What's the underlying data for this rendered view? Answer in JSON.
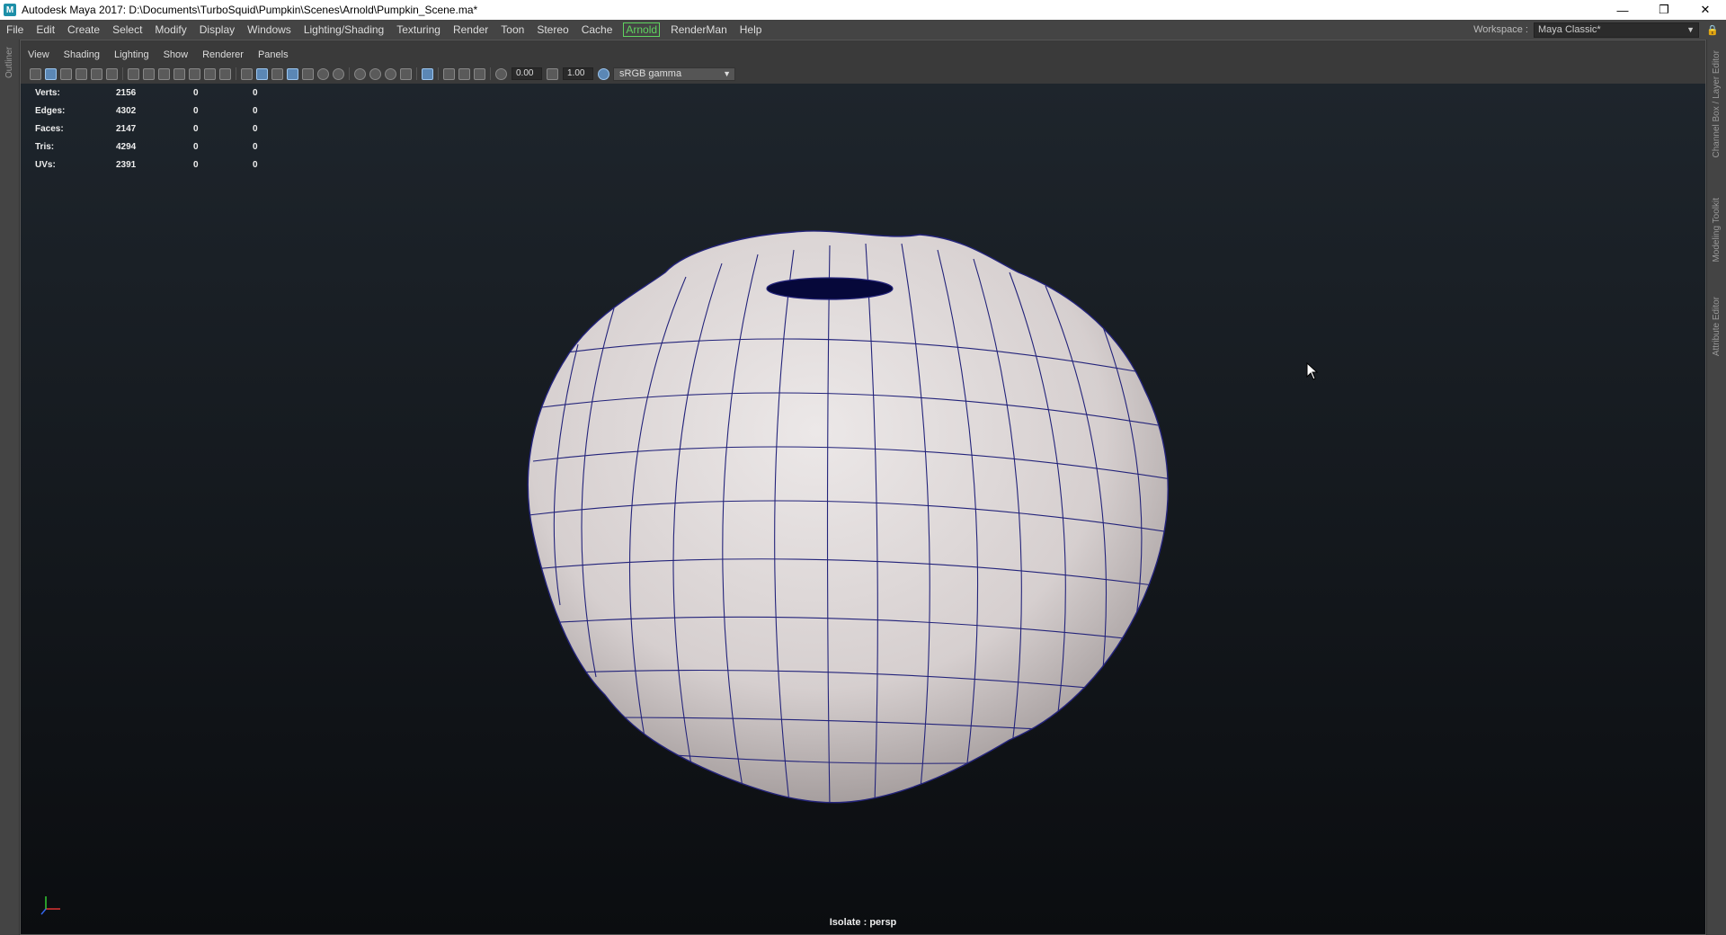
{
  "window": {
    "title": "Autodesk Maya 2017: D:\\Documents\\TurboSquid\\Pumpkin\\Scenes\\Arnold\\Pumpkin_Scene.ma*",
    "icon": "maya-app-icon",
    "minimize_glyph": "—",
    "maximize_glyph": "❐",
    "close_glyph": "✕"
  },
  "menubar": {
    "items": [
      "File",
      "Edit",
      "Create",
      "Select",
      "Modify",
      "Display",
      "Windows",
      "Lighting/Shading",
      "Texturing",
      "Render",
      "Toon",
      "Stereo",
      "Cache",
      "Arnold",
      "RenderMan",
      "Help"
    ],
    "workspace_label": "Workspace :",
    "workspace_value": "Maya Classic*"
  },
  "side_tabs": {
    "left": [
      "Outliner"
    ],
    "right": [
      "Channel Box / Layer Editor",
      "Modeling Toolkit",
      "Attribute Editor"
    ]
  },
  "panel": {
    "menus": [
      "View",
      "Shading",
      "Lighting",
      "Show",
      "Renderer",
      "Panels"
    ],
    "toolbar": {
      "exposure": "0.00",
      "gamma": "1.00",
      "color_space": "sRGB gamma"
    }
  },
  "hud": {
    "rows": [
      {
        "label": "Verts:",
        "total": "2156",
        "selected": "0",
        "sel2": "0"
      },
      {
        "label": "Edges:",
        "total": "4302",
        "selected": "0",
        "sel2": "0"
      },
      {
        "label": "Faces:",
        "total": "2147",
        "selected": "0",
        "sel2": "0"
      },
      {
        "label": "Tris:",
        "total": "4294",
        "selected": "0",
        "sel2": "0"
      },
      {
        "label": "UVs:",
        "total": "2391",
        "selected": "0",
        "sel2": "0"
      }
    ],
    "isolate_label": "Isolate : persp"
  },
  "colors": {
    "wireframe": "#23237a",
    "mesh_fill": "#d9d2d2",
    "arnold_accent": "#5fd35f",
    "active_button": "#5b87b5"
  }
}
